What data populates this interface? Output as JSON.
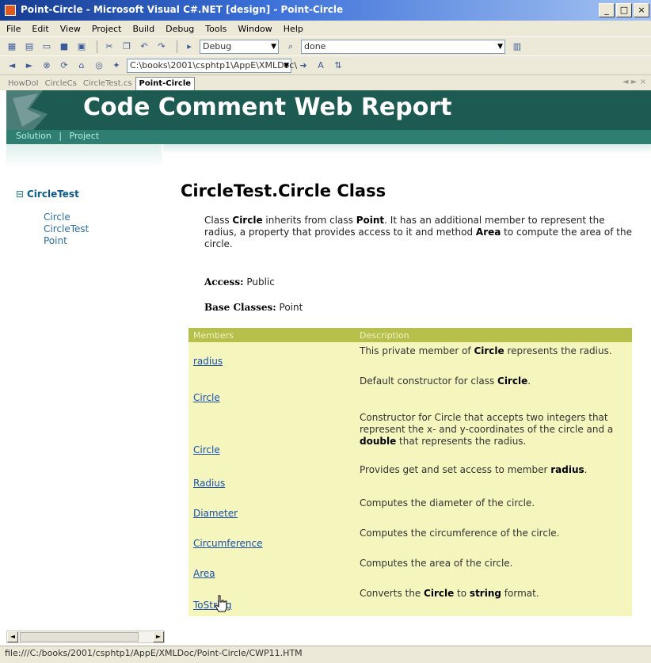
{
  "window": {
    "title": "Point-Circle - Microsoft Visual C#.NET [design] - Point-Circle",
    "min": "_",
    "max": "□",
    "close": "×"
  },
  "menu": [
    "File",
    "Edit",
    "View",
    "Project",
    "Build",
    "Debug",
    "Tools",
    "Window",
    "Help"
  ],
  "toolbar": {
    "config_combo": "Debug",
    "find_combo": "done",
    "address_combo": "C:\\books\\2001\\csphtp1\\AppE\\XMLDoc\\"
  },
  "doc_tabs": [
    "HowDoI",
    "CircleCs",
    "CircleTest.cs",
    "Point-Circle"
  ],
  "report": {
    "banner_title": "Code Comment Web Report",
    "nav": [
      "Solution",
      "|",
      "Project"
    ],
    "tree": {
      "root": "CircleTest",
      "items": [
        "Circle",
        "CircleTest",
        "Point"
      ]
    },
    "page_title": "CircleTest.Circle Class",
    "description": {
      "p1": "Class ",
      "b1": "Circle",
      "p2": " inherits from class ",
      "b2": "Point",
      "p3": ". It has an additional member to represent the radius, a property that provides access to it and method ",
      "b3": "Area",
      "p4": " to compute the area of the circle."
    },
    "access_label": "Access:",
    "access_value": "Public",
    "bases_label": "Base Classes:",
    "bases_value": "Point",
    "table_headers": [
      "Members",
      "Description"
    ],
    "members": [
      {
        "name": "radius",
        "desc": "This private member of **Circle** represents the radius."
      },
      {
        "name": "Circle",
        "desc": "Default constructor for class **Circle**."
      },
      {
        "name": "Circle",
        "desc": "Constructor for Circle that accepts two integers that represent the x- and y-coordinates of the circle and a **double** that represents the radius."
      },
      {
        "name": "Radius",
        "desc": "Provides get and set access to member **radius**."
      },
      {
        "name": "Diameter",
        "desc": "Computes the diameter of the circle."
      },
      {
        "name": "Circumference",
        "desc": "Computes the circumference of the circle."
      },
      {
        "name": "Area",
        "desc": "Computes the area of the circle."
      },
      {
        "name": "ToString",
        "desc": "Converts the **Circle** to **string** format."
      }
    ]
  },
  "status": "file:///C:/books/2001/csphtp1/AppE/XMLDoc/Point-Circle/CWP11.HTM",
  "colors": {
    "banner": "#1d5b52",
    "table_header": "#b7c04a",
    "table_body": "#f4f6bd",
    "title_bar": "#163c90"
  }
}
